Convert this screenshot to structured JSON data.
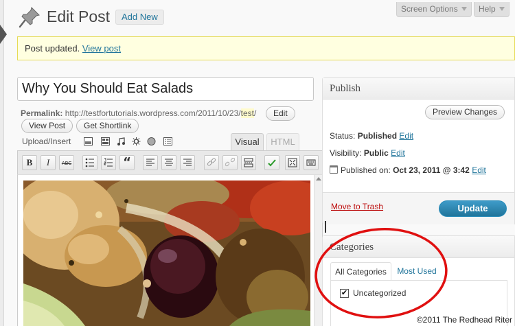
{
  "header": {
    "title": "Edit Post",
    "add_new": "Add New",
    "screen_options": "Screen Options",
    "help": "Help"
  },
  "notice": {
    "text": "Post updated.",
    "link": "View post"
  },
  "post": {
    "title": "Why You Should Eat Salads",
    "permalink_label": "Permalink:",
    "permalink_base": "http://testfortutorials.wordpress.com/2011/10/23/",
    "permalink_slug": "test",
    "permalink_end": "/",
    "edit_btn": "Edit",
    "view_post_btn": "View Post",
    "shortlink_btn": "Get Shortlink"
  },
  "editor": {
    "upload_label": "Upload/Insert",
    "tab_visual": "Visual",
    "tab_html": "HTML",
    "toolbar": {
      "bold": "B",
      "italic": "I",
      "strike": "ABC",
      "quote": "“"
    }
  },
  "publish": {
    "title": "Publish",
    "preview_btn": "Preview Changes",
    "status_label": "Status:",
    "status_value": "Published",
    "status_edit": "Edit",
    "visibility_label": "Visibility:",
    "visibility_value": "Public",
    "visibility_edit": "Edit",
    "published_label": "Published on:",
    "published_value": "Oct 23, 2011 @ 3:42",
    "published_edit": "Edit",
    "trash": "Move to Trash",
    "update": "Update"
  },
  "categories": {
    "title": "Categories",
    "tab_all": "All Categories",
    "tab_used": "Most Used",
    "items": [
      {
        "label": "Uncategorized",
        "checked": true
      }
    ]
  },
  "copyright": "©2011 The Redhead Riter",
  "colors": {
    "accent": "#21759b",
    "update_button": "#298cba",
    "annotation": "#e01010",
    "notice_bg": "#ffffe0"
  }
}
